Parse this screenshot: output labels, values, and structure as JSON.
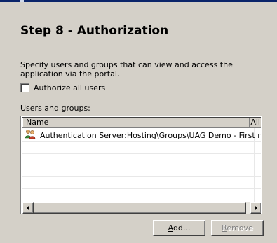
{
  "header": {
    "step_title": "Step 8 - Authorization"
  },
  "description": "Specify users and groups that can view and access the application via the portal.",
  "authorize_all": {
    "label": "Authorize all users",
    "checked": false
  },
  "users_groups": {
    "label": "Users and groups:",
    "columns": [
      "Name",
      "All"
    ],
    "rows": [
      {
        "name": "Authentication Server:Hosting\\Groups\\UAG Demo - First n...",
        "icon": "group-icon"
      }
    ]
  },
  "buttons": {
    "add_label": "Add...",
    "remove_label": "Remove"
  },
  "icons": {
    "scroll_left": "arrow-left-icon",
    "scroll_right": "arrow-right-icon"
  }
}
